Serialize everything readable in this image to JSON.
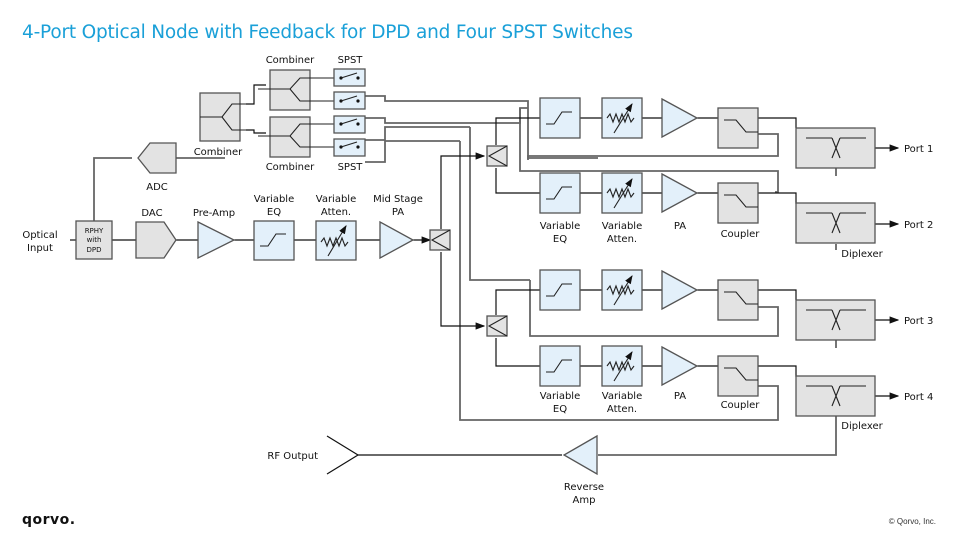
{
  "title": "4-Port Optical Node with Feedback for DPD and Four SPST Switches",
  "footer": {
    "logo": "qorvo.",
    "copyright": "© Qorvo, Inc."
  },
  "colors": {
    "title": "#1aa0d8",
    "blue_block": "#e3f0fa",
    "gray_block": "#e3e3e3"
  },
  "labels": {
    "optical_input_1": "Optical",
    "optical_input_2": "Input",
    "rphy_1": "RPHY",
    "rphy_2": "with",
    "rphy_3": "DPD",
    "dac": "DAC",
    "preamp": "Pre-Amp",
    "var_eq_1": "Variable",
    "var_eq_2": "EQ",
    "var_att_1": "Variable",
    "var_att_2": "Atten.",
    "mid_pa_1": "Mid Stage",
    "mid_pa_2": "PA",
    "adc": "ADC",
    "combiner_main": "Combiner",
    "combiner_top": "Combiner",
    "combiner_bottom": "Combiner",
    "spst_top": "SPST",
    "spst_bottom": "SPST",
    "pa": "PA",
    "coupler": "Coupler",
    "diplexer": "Diplexer",
    "ports": [
      "Port 1",
      "Port 2",
      "Port 3",
      "Port 4"
    ],
    "rf_output": "RF Output",
    "reverse_amp_1": "Reverse",
    "reverse_amp_2": "Amp"
  }
}
